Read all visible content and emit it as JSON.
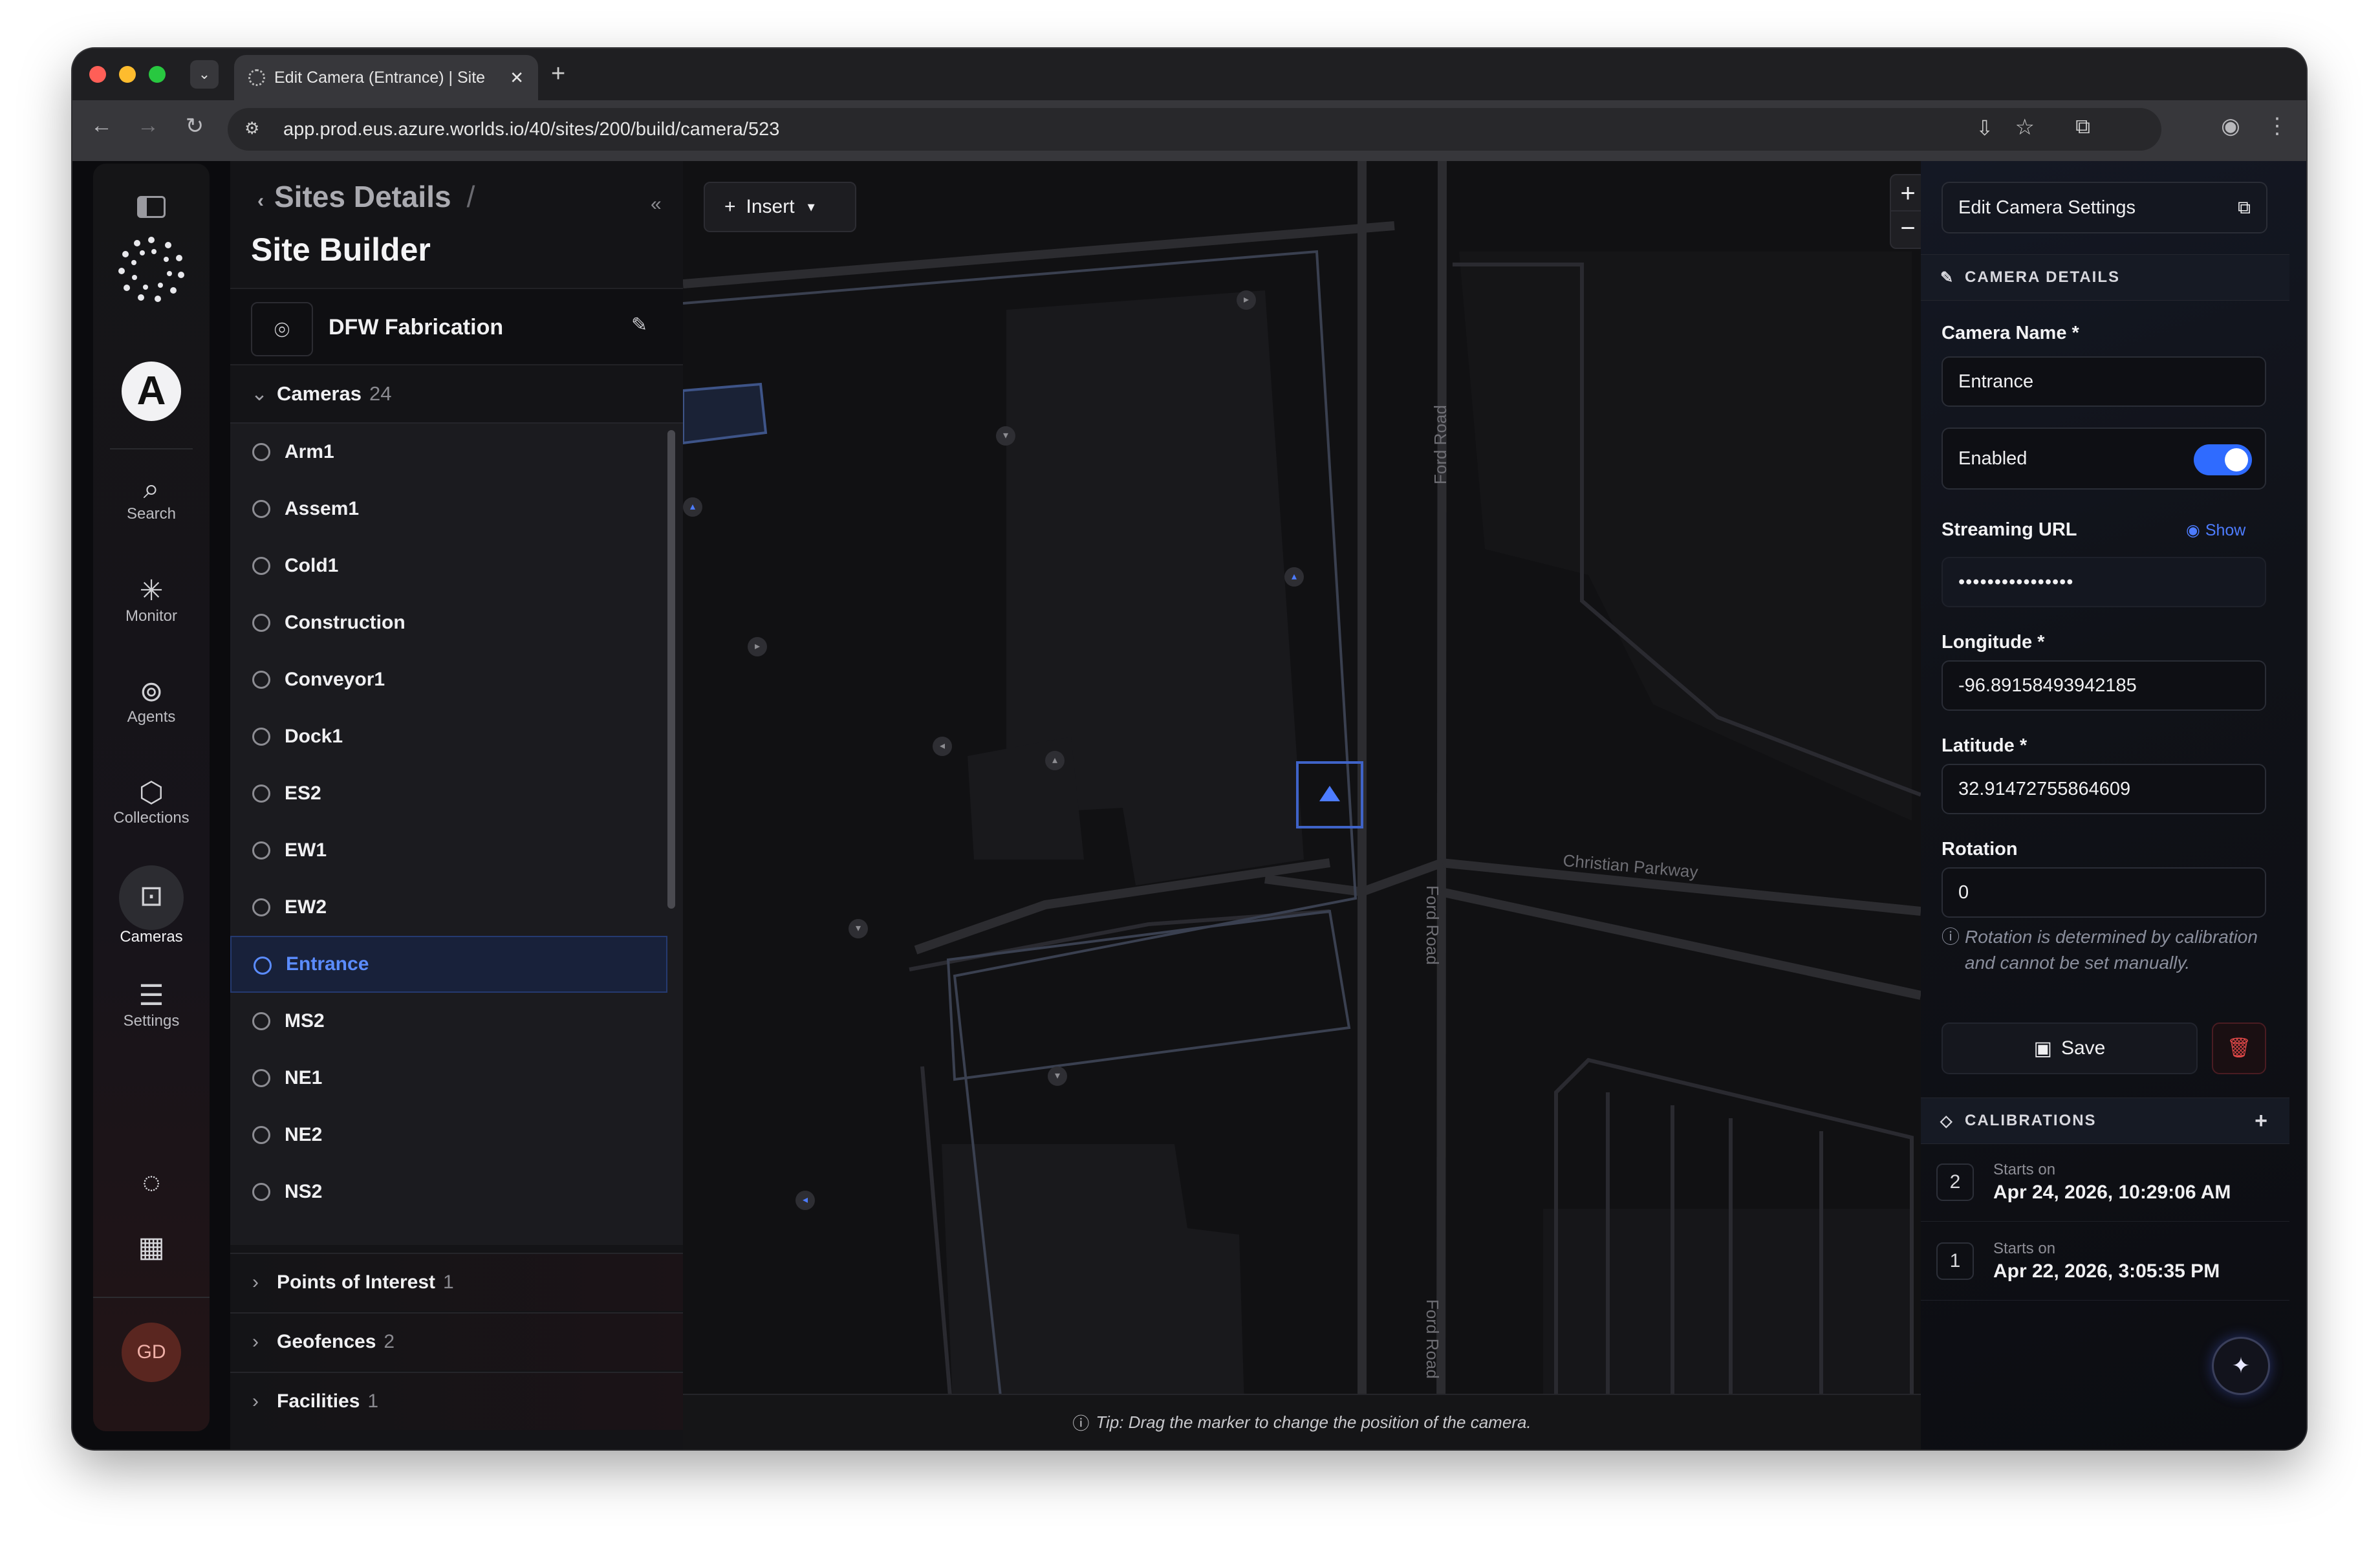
{
  "browser": {
    "tab_title": "Edit Camera (Entrance) | Site",
    "url": "app.prod.eus.azure.worlds.io/40/sites/200/build/camera/523"
  },
  "rail": {
    "items": [
      {
        "label": "Search",
        "icon": "search-icon"
      },
      {
        "label": "Monitor",
        "icon": "monitor-icon"
      },
      {
        "label": "Agents",
        "icon": "robot-icon"
      },
      {
        "label": "Collections",
        "icon": "collections-icon"
      },
      {
        "label": "Cameras",
        "icon": "camera-icon"
      },
      {
        "label": "Settings",
        "icon": "sliders-icon"
      }
    ],
    "avatar": "GD",
    "avatar_color": "#5a2620"
  },
  "panel": {
    "breadcrumb": "Sites Details",
    "title": "Site Builder",
    "site_name": "DFW Fabrication",
    "cameras_label": "Cameras",
    "cameras_count": "24",
    "cameras": [
      "Arm1",
      "Assem1",
      "Cold1",
      "Construction",
      "Conveyor1",
      "Dock1",
      "ES2",
      "EW1",
      "EW2",
      "Entrance",
      "MS2",
      "NE1",
      "NE2",
      "NS2"
    ],
    "selected": "Entrance",
    "sections": [
      {
        "label": "Points of Interest",
        "count": "1"
      },
      {
        "label": "Geofences",
        "count": "2"
      },
      {
        "label": "Facilities",
        "count": "1"
      }
    ]
  },
  "map": {
    "insert_label": "Insert",
    "road_labels": [
      "Ford Road",
      "Christian Parkway",
      "Ford Road",
      "Ford Road"
    ],
    "tip": "Tip: Drag the marker to change the position of the camera."
  },
  "right": {
    "edit_settings": "Edit Camera Settings",
    "details_header": "CAMERA DETAILS",
    "camera_name_label": "Camera Name *",
    "camera_name": "Entrance",
    "enabled_label": "Enabled",
    "enabled": true,
    "streaming_label": "Streaming URL",
    "show_label": "Show",
    "streaming_value": "••••••••••••••••",
    "longitude_label": "Longitude *",
    "longitude": "-96.89158493942185",
    "latitude_label": "Latitude *",
    "latitude": "32.91472755864609",
    "rotation_label": "Rotation",
    "rotation": "0",
    "rotation_note": "Rotation is determined by calibration and cannot be set manually.",
    "save_label": "Save",
    "calibrations_header": "CALIBRATIONS",
    "calibrations": [
      {
        "n": "2",
        "starts": "Starts on",
        "date": "Apr 24, 2026, 10:29:06 AM"
      },
      {
        "n": "1",
        "starts": "Starts on",
        "date": "Apr 22, 2026, 3:05:35 PM"
      }
    ],
    "accent": "#2f6bff"
  }
}
